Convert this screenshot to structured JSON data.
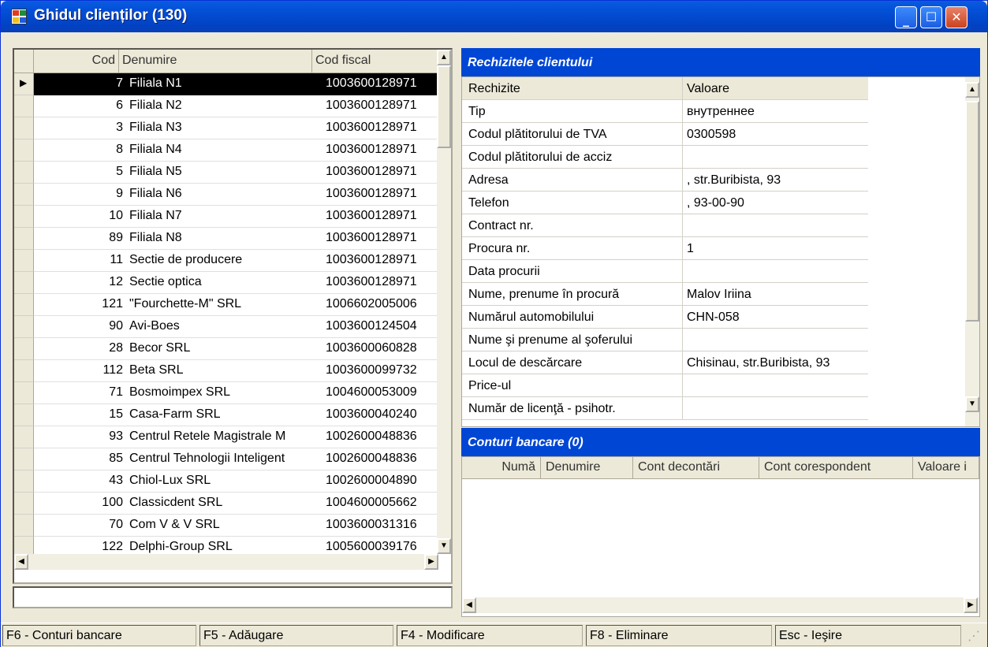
{
  "window": {
    "title": "Ghidul clienților (130)"
  },
  "grid": {
    "columns": [
      "Cod",
      "Denumire",
      "Cod fiscal"
    ],
    "rows": [
      {
        "cod": "7",
        "den": "Filiala N1",
        "fis": "1003600128971"
      },
      {
        "cod": "6",
        "den": "Filiala N2",
        "fis": "1003600128971"
      },
      {
        "cod": "3",
        "den": "Filiala N3",
        "fis": "1003600128971"
      },
      {
        "cod": "8",
        "den": "Filiala N4",
        "fis": "1003600128971"
      },
      {
        "cod": "5",
        "den": "Filiala N5",
        "fis": "1003600128971"
      },
      {
        "cod": "9",
        "den": "Filiala N6",
        "fis": "1003600128971"
      },
      {
        "cod": "10",
        "den": "Filiala N7",
        "fis": "1003600128971"
      },
      {
        "cod": "89",
        "den": "Filiala N8",
        "fis": "1003600128971"
      },
      {
        "cod": "11",
        "den": "Sectie de producere",
        "fis": "1003600128971"
      },
      {
        "cod": "12",
        "den": "Sectie optica",
        "fis": "1003600128971"
      },
      {
        "cod": "121",
        "den": "\"Fourchette-M\" SRL",
        "fis": "1006602005006"
      },
      {
        "cod": "90",
        "den": "Avi-Boes",
        "fis": "1003600124504"
      },
      {
        "cod": "28",
        "den": "Becor SRL",
        "fis": "1003600060828"
      },
      {
        "cod": "112",
        "den": "Beta SRL",
        "fis": "1003600099732"
      },
      {
        "cod": "71",
        "den": "Bosmoimpex SRL",
        "fis": "1004600053009"
      },
      {
        "cod": "15",
        "den": "Casa-Farm SRL",
        "fis": "1003600040240"
      },
      {
        "cod": "93",
        "den": "Centrul Retele Magistrale M",
        "fis": "1002600048836"
      },
      {
        "cod": "85",
        "den": "Centrul Tehnologii Inteligent",
        "fis": "1002600048836"
      },
      {
        "cod": "43",
        "den": "Chiol-Lux SRL",
        "fis": "1002600004890"
      },
      {
        "cod": "100",
        "den": "Classicdent SRL",
        "fis": "1004600005662"
      },
      {
        "cod": "70",
        "den": "Com V & V SRL",
        "fis": "1003600031316"
      },
      {
        "cod": "122",
        "den": "Delphi-Group SRL",
        "fis": "1005600039176"
      }
    ]
  },
  "requisites": {
    "title": "Rechizitele clientului",
    "header": {
      "key": "Rechizite",
      "value": "Valoare"
    },
    "rows": [
      {
        "k": "Tip",
        "v": "внутреннее"
      },
      {
        "k": "Codul plătitorului de TVA",
        "v": "0300598"
      },
      {
        "k": "Codul plătitorului de acciz",
        "v": ""
      },
      {
        "k": "Adresa",
        "v": ", str.Buribista, 93"
      },
      {
        "k": "Telefon",
        "v": ", 93-00-90"
      },
      {
        "k": "Contract nr.",
        "v": ""
      },
      {
        "k": "Procura nr.",
        "v": "1"
      },
      {
        "k": "Data procurii",
        "v": ""
      },
      {
        "k": "Nume, prenume în procură",
        "v": "Malov Iriina"
      },
      {
        "k": "Numărul automobilului",
        "v": "CHN-058"
      },
      {
        "k": "Nume şi prenume al şoferului",
        "v": ""
      },
      {
        "k": "Locul de descărcare",
        "v": "Chisinau, str.Buribista, 93"
      },
      {
        "k": "Price-ul",
        "v": ""
      },
      {
        "k": "Număr de licenţă - psihotr.",
        "v": ""
      }
    ]
  },
  "banks": {
    "title": "Conturi bancare (0)",
    "columns": [
      "Numă",
      "Denumire",
      "Cont decontări",
      "Cont corespondent",
      "Valoare i"
    ]
  },
  "status": [
    "F6 - Conturi bancare",
    "F5 - Adăugare",
    "F4 - Modificare",
    "F8 - Eliminare",
    "Esc - Ieşire"
  ]
}
